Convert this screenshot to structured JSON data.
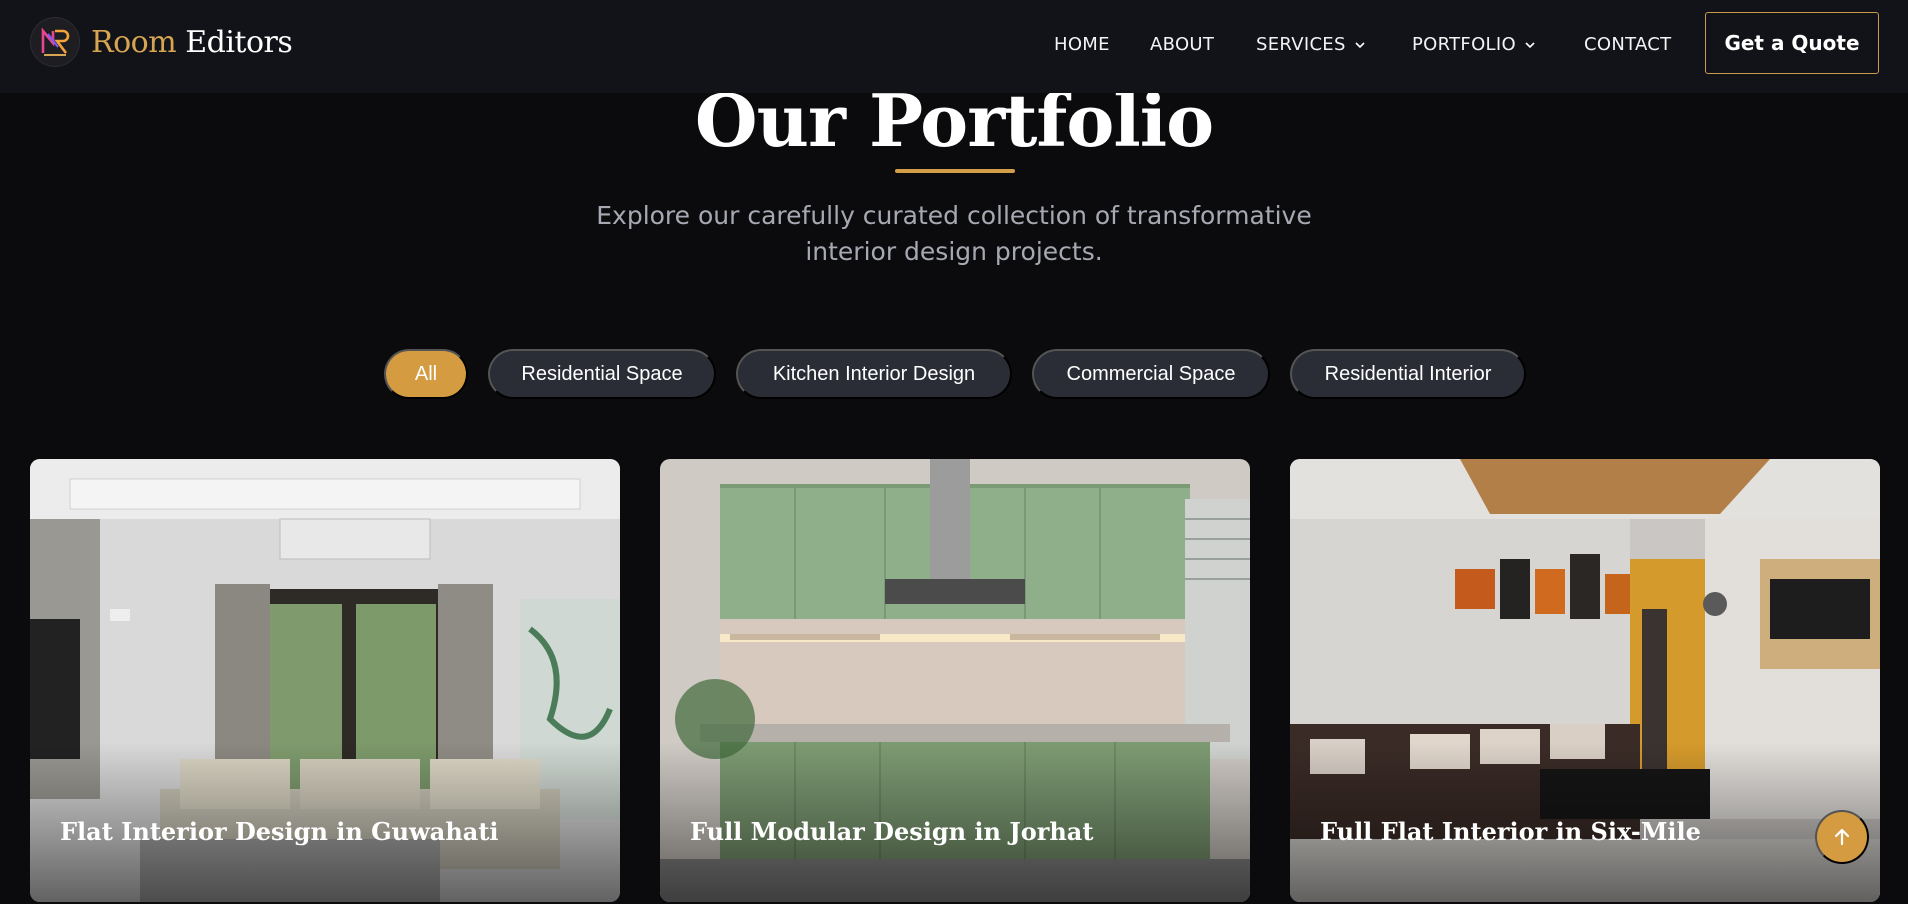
{
  "brand": {
    "name_part1": "Room",
    "name_part2": "Editors",
    "logo_icon": "rm-logo-icon"
  },
  "nav": {
    "items": [
      {
        "label": "HOME",
        "has_dropdown": false
      },
      {
        "label": "ABOUT",
        "has_dropdown": false
      },
      {
        "label": "SERVICES",
        "has_dropdown": true
      },
      {
        "label": "PORTFOLIO",
        "has_dropdown": true
      },
      {
        "label": "CONTACT",
        "has_dropdown": false
      }
    ],
    "cta": "Get a Quote"
  },
  "hero": {
    "title": "Our Portfolio",
    "subtitle": "Explore our carefully curated collection of transformative interior design projects."
  },
  "filters": [
    {
      "label": "All",
      "active": true
    },
    {
      "label": "Residential Space",
      "active": false
    },
    {
      "label": "Kitchen Interior Design",
      "active": false
    },
    {
      "label": "Commercial Space",
      "active": false
    },
    {
      "label": "Residential Interior",
      "active": false
    }
  ],
  "projects": [
    {
      "title": "Flat Interior Design in Guwahati"
    },
    {
      "title": "Full Modular Design in Jorhat"
    },
    {
      "title": "Full Flat Interior in Six-Mile"
    }
  ],
  "colors": {
    "accent": "#d49b41",
    "background": "#0b0b0e",
    "nav_bg": "#121318",
    "chip_bg": "#2a2d35"
  },
  "scroll_top_icon": "arrow-up-icon"
}
